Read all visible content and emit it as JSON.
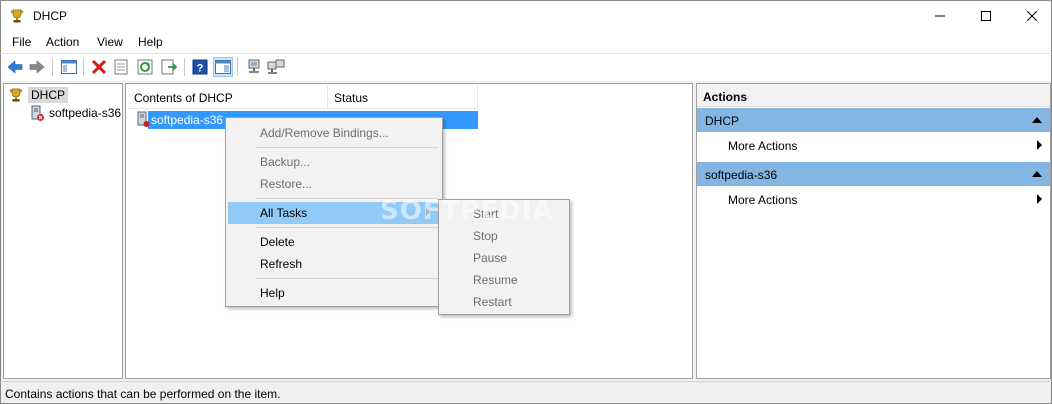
{
  "window": {
    "title": "DHCP"
  },
  "menu": {
    "file": "File",
    "action": "Action",
    "view": "View",
    "help": "Help"
  },
  "tree": {
    "root": "DHCP",
    "child": "softpedia-s36"
  },
  "content": {
    "columns": [
      "Contents of DHCP",
      "Status"
    ],
    "rows": [
      {
        "name": "softpedia-s36",
        "status": ""
      }
    ]
  },
  "context_menu": {
    "add_remove": "Add/Remove Bindings...",
    "backup": "Backup...",
    "restore": "Restore...",
    "all_tasks": "All Tasks",
    "delete": "Delete",
    "refresh": "Refresh",
    "help": "Help"
  },
  "submenu": {
    "start": "Start",
    "stop": "Stop",
    "pause": "Pause",
    "resume": "Resume",
    "restart": "Restart"
  },
  "actions_pane": {
    "header": "Actions",
    "groups": [
      {
        "title": "DHCP",
        "item": "More Actions"
      },
      {
        "title": "softpedia-s36",
        "item": "More Actions"
      }
    ]
  },
  "status_bar": {
    "text": "Contains actions that can be performed on the item."
  },
  "watermark": "SOFTPEDIA",
  "colors": {
    "selection": "#3399ff",
    "menu_highlight": "#91c9f7",
    "action_group": "#83b6e3"
  }
}
